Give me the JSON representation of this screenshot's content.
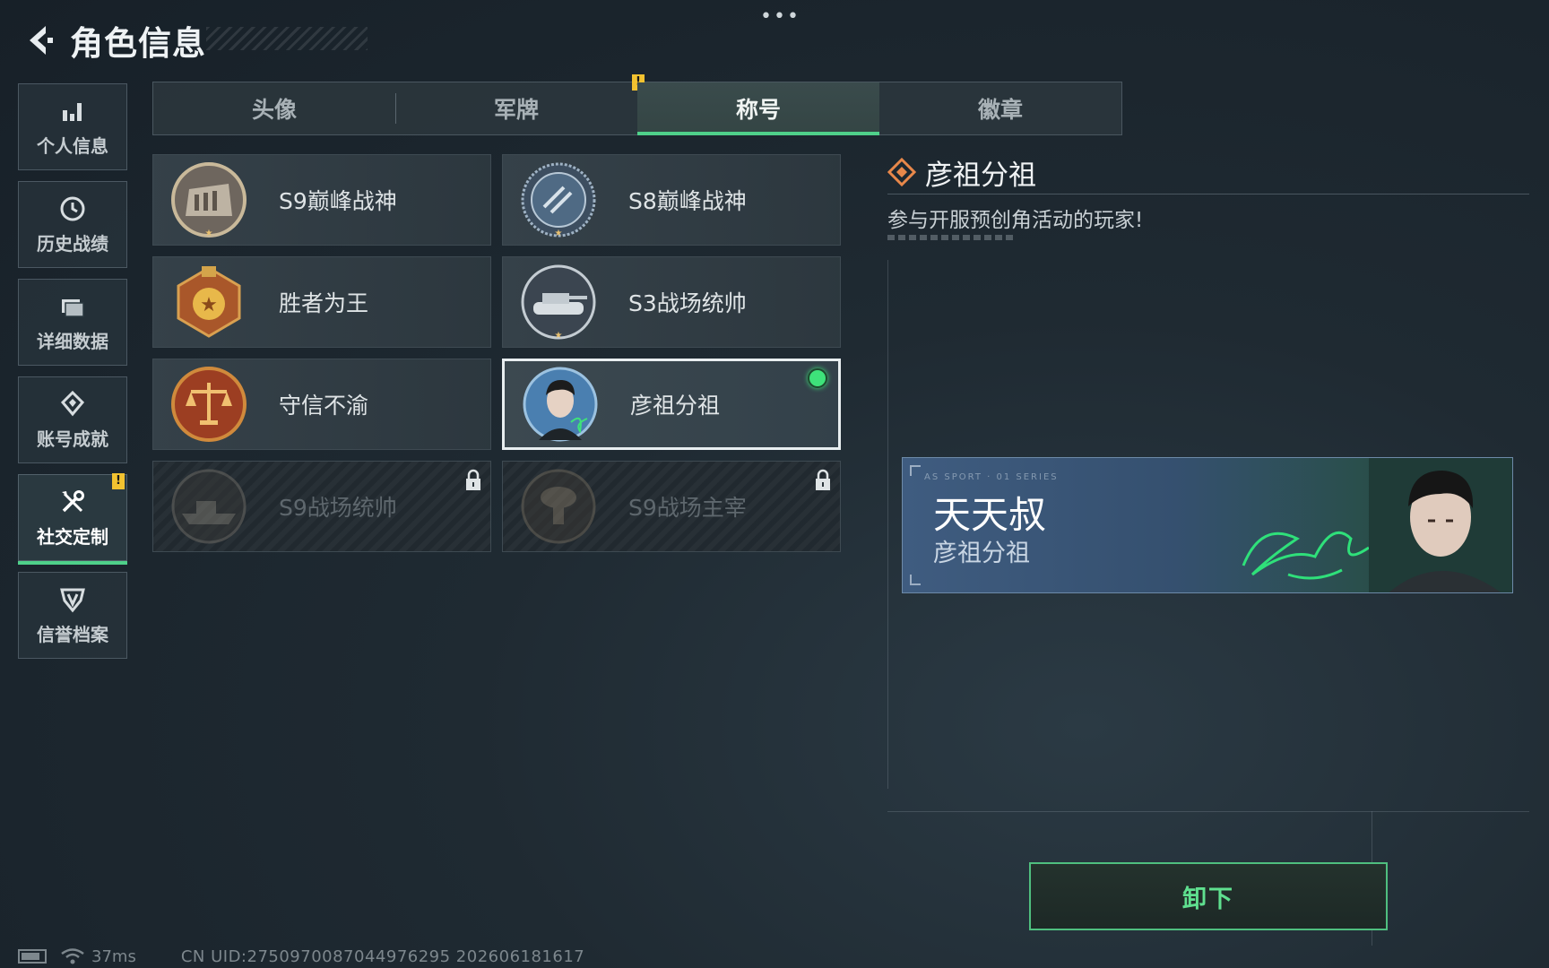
{
  "header": {
    "title": "角色信息",
    "more": "•••"
  },
  "sidebar": {
    "items": [
      {
        "label": "个人信息",
        "icon": "bar-chart-icon",
        "active": false
      },
      {
        "label": "历史战绩",
        "icon": "history-icon",
        "active": false
      },
      {
        "label": "详细数据",
        "icon": "folder-icon",
        "active": false
      },
      {
        "label": "账号成就",
        "icon": "achievement-icon",
        "active": false
      },
      {
        "label": "社交定制",
        "icon": "tools-icon",
        "active": true,
        "badge": "!"
      },
      {
        "label": "信誉档案",
        "icon": "credit-shield-icon",
        "active": false
      }
    ]
  },
  "tabs": [
    {
      "label": "头像",
      "active": false
    },
    {
      "label": "军牌",
      "active": false,
      "badge": "!"
    },
    {
      "label": "称号",
      "active": true
    },
    {
      "label": "徽章",
      "active": false
    }
  ],
  "titles": [
    {
      "label": "S9巅峰战神",
      "emblem": "fortress-emblem",
      "state": "owned"
    },
    {
      "label": "S8巅峰战神",
      "emblem": "blue-laurel-emblem",
      "state": "owned"
    },
    {
      "label": "胜者为王",
      "emblem": "gold-medal-emblem",
      "state": "owned"
    },
    {
      "label": "S3战场统帅",
      "emblem": "tank-emblem",
      "state": "owned"
    },
    {
      "label": "守信不渝",
      "emblem": "scales-emblem",
      "state": "owned"
    },
    {
      "label": "彦祖分祖",
      "emblem": "portrait-emblem",
      "state": "selected-equipped"
    },
    {
      "label": "S9战场统帅",
      "emblem": "warship-emblem",
      "state": "locked"
    },
    {
      "label": "S9战场主宰",
      "emblem": "mushroom-cloud-emblem",
      "state": "locked"
    }
  ],
  "detail": {
    "name": "彦祖分祖",
    "description": "参与开服预创角活动的玩家!",
    "preview": {
      "player_name": "天天叔",
      "title": "彦祖分祖",
      "tiny_text": "AS SPORT · 01 SERIES"
    },
    "button_label": "卸下"
  },
  "status": {
    "ping": "37ms",
    "uid": "CN UID:2750970087044976295 202606181617"
  },
  "colors": {
    "accent_green": "#4fd08a",
    "badge_yellow": "#f2c230",
    "background": "#1f2a32"
  }
}
